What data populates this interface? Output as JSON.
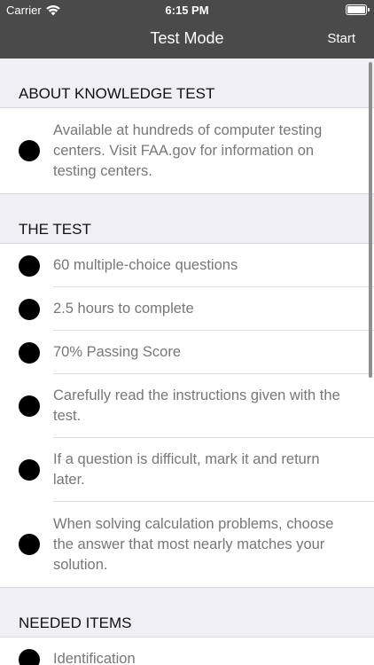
{
  "status": {
    "carrier": "Carrier",
    "time": "6:15 PM"
  },
  "nav": {
    "title": "Test Mode",
    "start_label": "Start"
  },
  "sections": [
    {
      "header": "ABOUT KNOWLEDGE TEST",
      "items": [
        "Available at hundreds of computer testing centers. Visit FAA.gov for information on testing centers."
      ]
    },
    {
      "header": "THE TEST",
      "items": [
        "60 multiple-choice questions",
        "2.5 hours to complete",
        "70% Passing Score",
        "Carefully read the instructions given with the test.",
        "If a question is difficult, mark it and return later.",
        "When solving calculation problems, choose the answer that most nearly matches your solution."
      ]
    },
    {
      "header": "NEEDED ITEMS",
      "items": [
        "Identification"
      ]
    }
  ],
  "colors": {
    "nav_bg": "#4a4a4a",
    "background": "#efeff4",
    "item_text": "#777777",
    "bullet": "#000000"
  }
}
